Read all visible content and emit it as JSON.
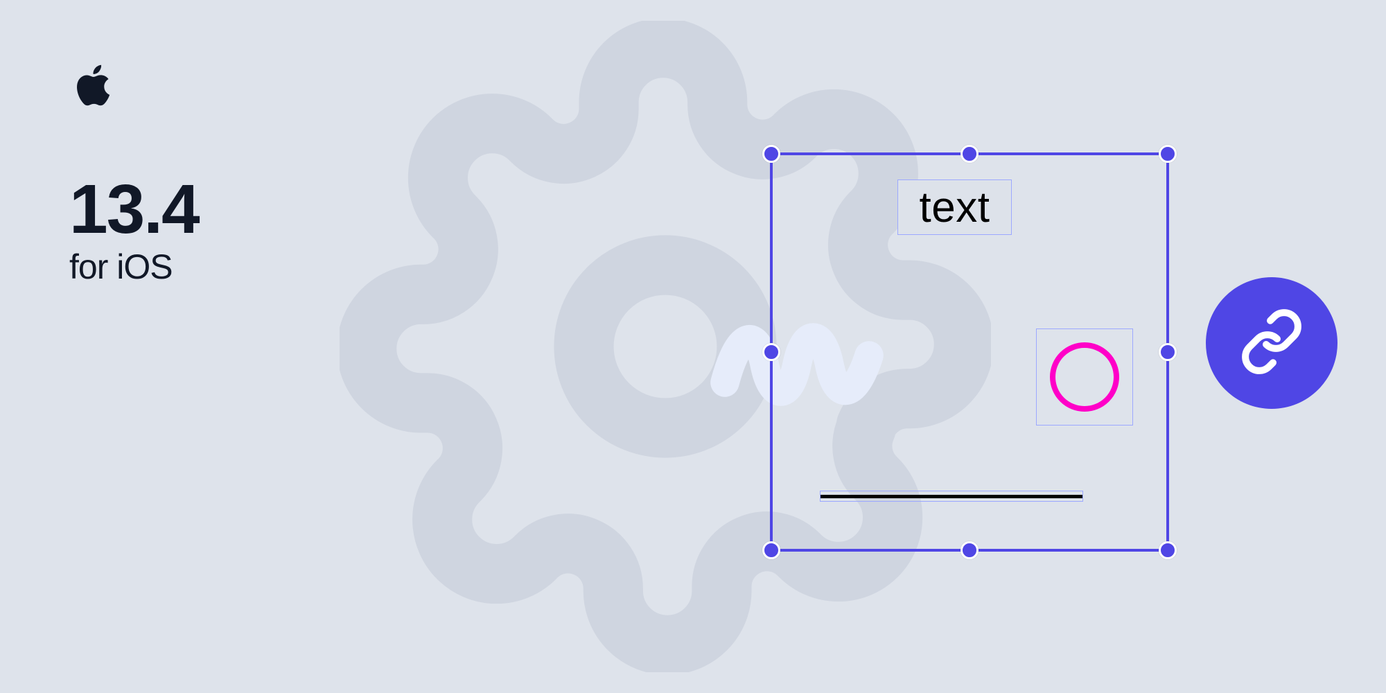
{
  "brand": {
    "icon": "apple-logo"
  },
  "version": {
    "number": "13.4",
    "subtitle": "for iOS"
  },
  "background": {
    "icon": "gear"
  },
  "canvas": {
    "scribble_icon": "scribble",
    "text_element": {
      "label": "text"
    },
    "circle_element": {
      "shape": "circle",
      "stroke": "#ff00c8"
    },
    "line_element": {
      "shape": "line"
    },
    "selection_handles": 8
  },
  "actions": {
    "link_button_icon": "link"
  },
  "colors": {
    "background": "#dee3eb",
    "accent": "#4f46e5",
    "text": "#111827",
    "gear": "#cfd5e0",
    "scribble": "#e6ecfa",
    "magenta": "#ff00c8"
  }
}
